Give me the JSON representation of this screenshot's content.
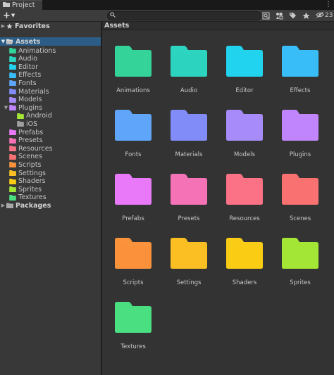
{
  "tab": {
    "title": "Project"
  },
  "toolbar": {
    "add_label": "+",
    "search": {
      "value": "",
      "placeholder": ""
    },
    "hidden_count": "23",
    "icons": [
      "search-icon",
      "scene-filter-icon",
      "type-filter-icon",
      "label-filter-icon",
      "favorite-star-icon",
      "visibility-eye-icon"
    ]
  },
  "sidebar": {
    "favorites": "Favorites",
    "assets": "Assets",
    "packages": "Packages",
    "items": [
      {
        "label": "Animations",
        "color": "#34d399",
        "depth": 1
      },
      {
        "label": "Audio",
        "color": "#2dd4bf",
        "depth": 1
      },
      {
        "label": "Editor",
        "color": "#22d3ee",
        "depth": 1
      },
      {
        "label": "Effects",
        "color": "#38bdf8",
        "depth": 1
      },
      {
        "label": "Fonts",
        "color": "#60a5fa",
        "depth": 1
      },
      {
        "label": "Materials",
        "color": "#818cf8",
        "depth": 1
      },
      {
        "label": "Models",
        "color": "#a78bfa",
        "depth": 1
      },
      {
        "label": "Plugins",
        "color": "#c084fc",
        "depth": 1,
        "expanded": true
      },
      {
        "label": "Android",
        "color": "#a3e635",
        "depth": 2
      },
      {
        "label": "iOS",
        "color": "#a0a0a0",
        "depth": 2
      },
      {
        "label": "Prefabs",
        "color": "#e879f9",
        "depth": 1
      },
      {
        "label": "Presets",
        "color": "#f472b6",
        "depth": 1
      },
      {
        "label": "Resources",
        "color": "#fb7185",
        "depth": 1
      },
      {
        "label": "Scenes",
        "color": "#f87171",
        "depth": 1
      },
      {
        "label": "Scripts",
        "color": "#fb923c",
        "depth": 1
      },
      {
        "label": "Settings",
        "color": "#fbbf24",
        "depth": 1
      },
      {
        "label": "Shaders",
        "color": "#facc15",
        "depth": 1
      },
      {
        "label": "Sprites",
        "color": "#a3e635",
        "depth": 1
      },
      {
        "label": "Textures",
        "color": "#4ade80",
        "depth": 1
      }
    ]
  },
  "main": {
    "header": "Assets",
    "tiles": [
      {
        "name": "Animations",
        "color": "#34d399"
      },
      {
        "name": "Audio",
        "color": "#2dd4bf"
      },
      {
        "name": "Editor",
        "color": "#22d3ee"
      },
      {
        "name": "Effects",
        "color": "#38bdf8"
      },
      {
        "name": "Fonts",
        "color": "#60a5fa"
      },
      {
        "name": "Materials",
        "color": "#818cf8"
      },
      {
        "name": "Models",
        "color": "#a78bfa"
      },
      {
        "name": "Plugins",
        "color": "#c084fc"
      },
      {
        "name": "Prefabs",
        "color": "#e879f9"
      },
      {
        "name": "Presets",
        "color": "#f472b6"
      },
      {
        "name": "Resources",
        "color": "#fb7185"
      },
      {
        "name": "Scenes",
        "color": "#f87171"
      },
      {
        "name": "Scripts",
        "color": "#fb923c"
      },
      {
        "name": "Settings",
        "color": "#fbbf24"
      },
      {
        "name": "Shaders",
        "color": "#facc15"
      },
      {
        "name": "Sprites",
        "color": "#a3e635"
      },
      {
        "name": "Textures",
        "color": "#4ade80"
      }
    ]
  }
}
